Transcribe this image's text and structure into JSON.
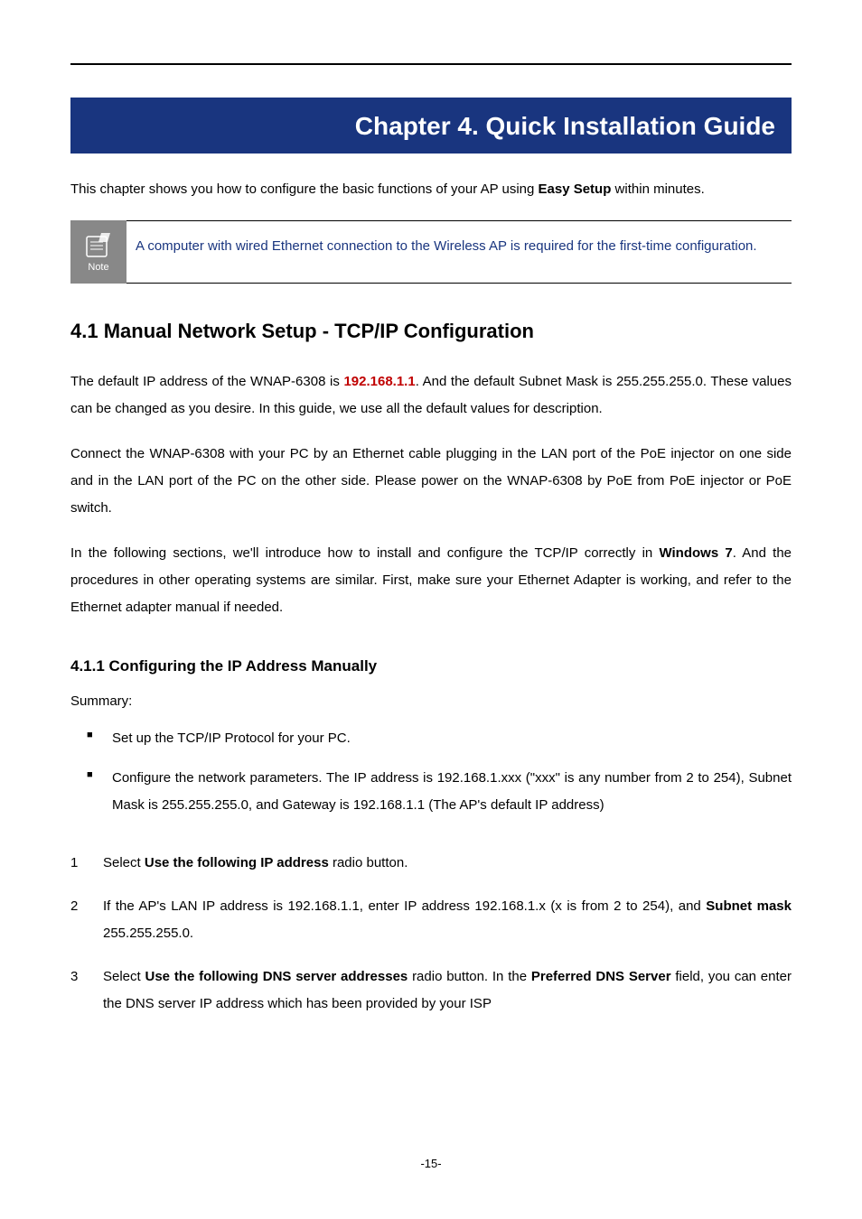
{
  "chapter": {
    "title": "Chapter 4.   Quick Installation Guide"
  },
  "intro": {
    "prefix": "This chapter shows you how to configure the basic functions of your AP using ",
    "bold": "Easy Setup",
    "suffix": " within minutes."
  },
  "note": {
    "label": "Note",
    "text": "A computer with wired Ethernet connection to the Wireless AP is required for the first-time configuration."
  },
  "section_4_1": {
    "heading": "4.1  Manual Network Setup - TCP/IP Configuration",
    "p1_a": "The default IP address of the WNAP-6308 is ",
    "p1_ip": "192.168.1.1",
    "p1_b": ". And the default Subnet Mask is 255.255.255.0. These values can be changed as you desire. In this guide, we use all the default values for description.",
    "p2": "Connect the WNAP-6308 with your PC by an Ethernet cable plugging in the LAN port of the PoE injector on one side and in the LAN port of the PC on the other side. Please power on the WNAP-6308 by PoE from PoE injector or PoE switch.",
    "p3_a": "In the following sections, we'll introduce how to install and configure the TCP/IP correctly in ",
    "p3_bold": "Windows 7",
    "p3_b": ". And the procedures in other operating systems are similar. First, make sure your Ethernet Adapter is working, and refer to the Ethernet adapter manual if needed."
  },
  "section_4_1_1": {
    "heading": "4.1.1  Configuring the IP Address Manually",
    "summary_label": "Summary:",
    "bullets": [
      "Set up the TCP/IP Protocol for your PC.",
      "Configure the network parameters. The IP address is 192.168.1.xxx (\"xxx\" is any number from 2 to 254), Subnet Mask is 255.255.255.0, and Gateway is 192.168.1.1 (The AP's default IP address)"
    ],
    "steps": [
      {
        "num": "1",
        "a": "Select ",
        "b1": "Use the following IP address",
        "c": " radio button."
      },
      {
        "num": "2",
        "a": "If the AP's LAN IP address is 192.168.1.1, enter IP address 192.168.1.x (x is from 2 to 254), and ",
        "b1": "Subnet mask",
        "c": " 255.255.255.0."
      },
      {
        "num": "3",
        "a": "Select ",
        "b1": "Use the following DNS server addresses",
        "mid": " radio button. In the ",
        "b2": "Preferred DNS Server",
        "c": " field, you can enter the DNS server IP address which has been provided by your ISP"
      }
    ]
  },
  "footer": {
    "page": "-15-"
  }
}
